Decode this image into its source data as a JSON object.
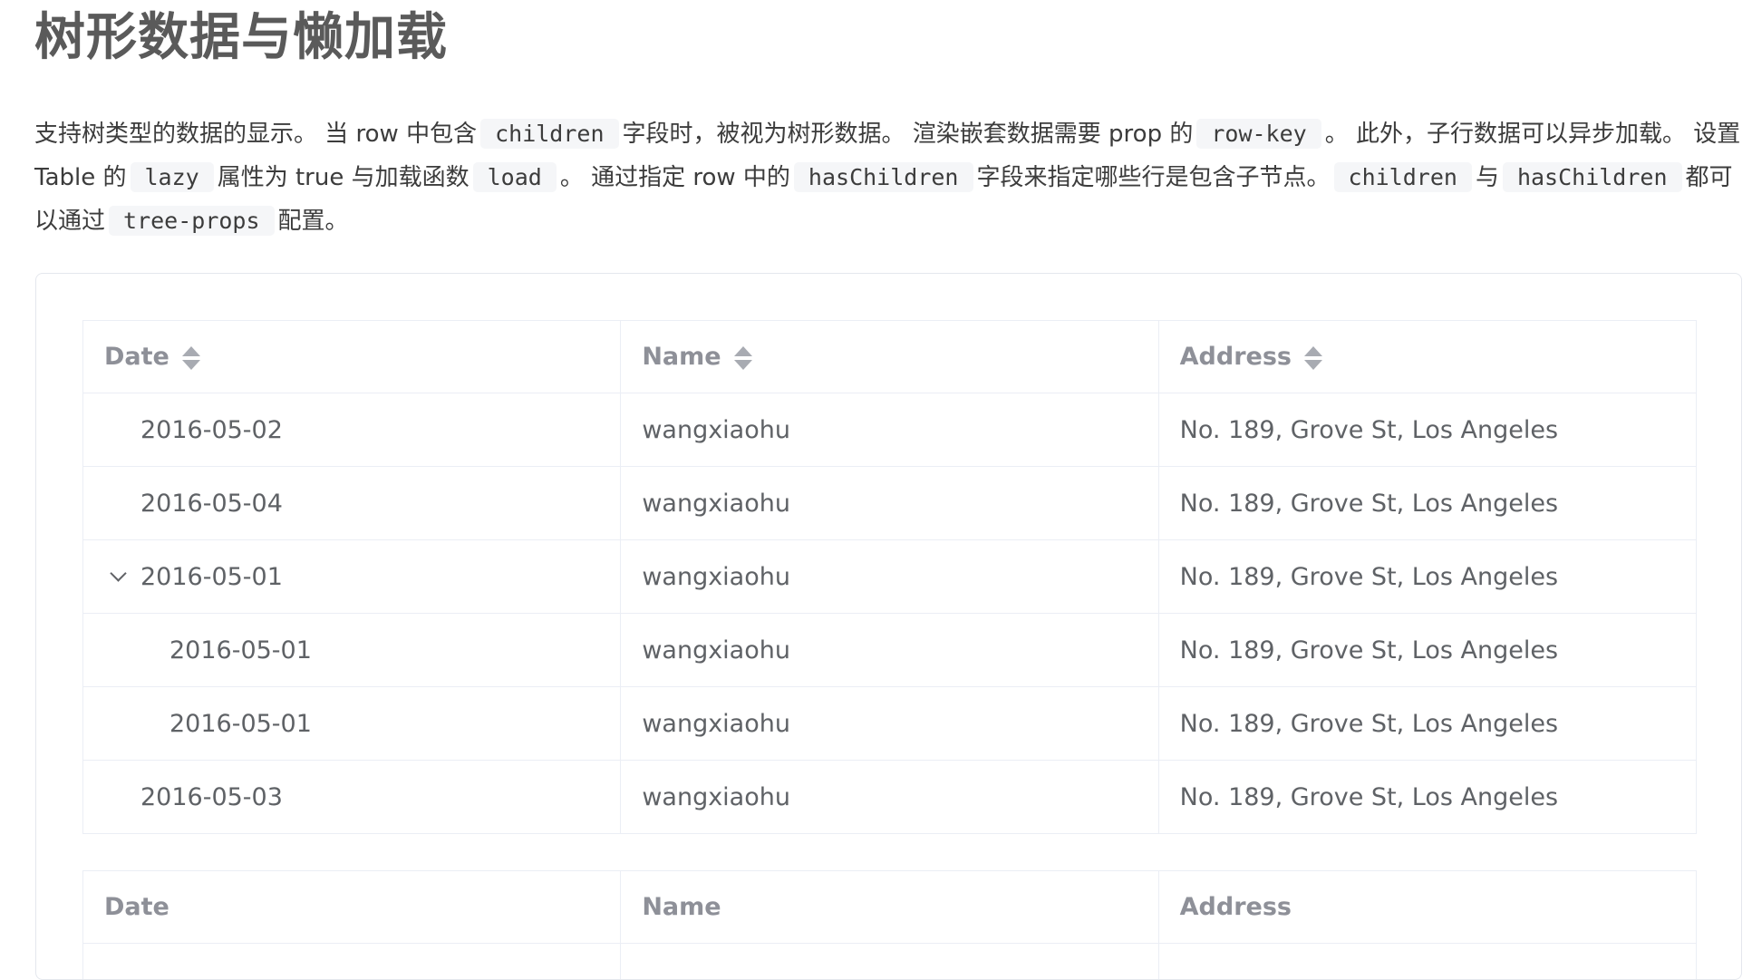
{
  "page": {
    "title": "树形数据与懒加载"
  },
  "description": {
    "p1": "支持树类型的数据的显示。 当 row 中包含",
    "code1": "children",
    "p2": "字段时，被视为树形数据。 渲染嵌套数据需要 prop 的",
    "code2": "row-key",
    "p3": "。 此外，子行数据可以异步加载。 设置 Table 的",
    "code3": "lazy",
    "p4": "属性为 true 与加载函数",
    "code4": "load",
    "p5": "。 通过指定 row 中的",
    "code5": "hasChildren",
    "p6": "字段来指定哪些行是包含子节点。",
    "code6": "children",
    "p7": "与",
    "code7": "hasChildren",
    "p8": "都可以通过",
    "code8": "tree-props",
    "p9": "配置。"
  },
  "table1": {
    "headers": [
      "Date",
      "Name",
      "Address"
    ],
    "rows": [
      {
        "date": "2016-05-02",
        "name": "wangxiaohu",
        "address": "No. 189, Grove St, Los Angeles"
      },
      {
        "date": "2016-05-04",
        "name": "wangxiaohu",
        "address": "No. 189, Grove St, Los Angeles"
      },
      {
        "date": "2016-05-01",
        "name": "wangxiaohu",
        "address": "No. 189, Grove St, Los Angeles"
      },
      {
        "date": "2016-05-01",
        "name": "wangxiaohu",
        "address": "No. 189, Grove St, Los Angeles"
      },
      {
        "date": "2016-05-01",
        "name": "wangxiaohu",
        "address": "No. 189, Grove St, Los Angeles"
      },
      {
        "date": "2016-05-03",
        "name": "wangxiaohu",
        "address": "No. 189, Grove St, Los Angeles"
      }
    ]
  },
  "table2": {
    "headers": [
      "Date",
      "Name",
      "Address"
    ]
  },
  "icons": {
    "sort": "sort-caret-icon",
    "expand": "chevron-down-icon"
  },
  "colors": {
    "title": "#5a5a5a",
    "header_text": "#8e9098",
    "cell_text": "#5f6266",
    "border": "#ebeef5",
    "code_bg": "#f5f6f8"
  }
}
